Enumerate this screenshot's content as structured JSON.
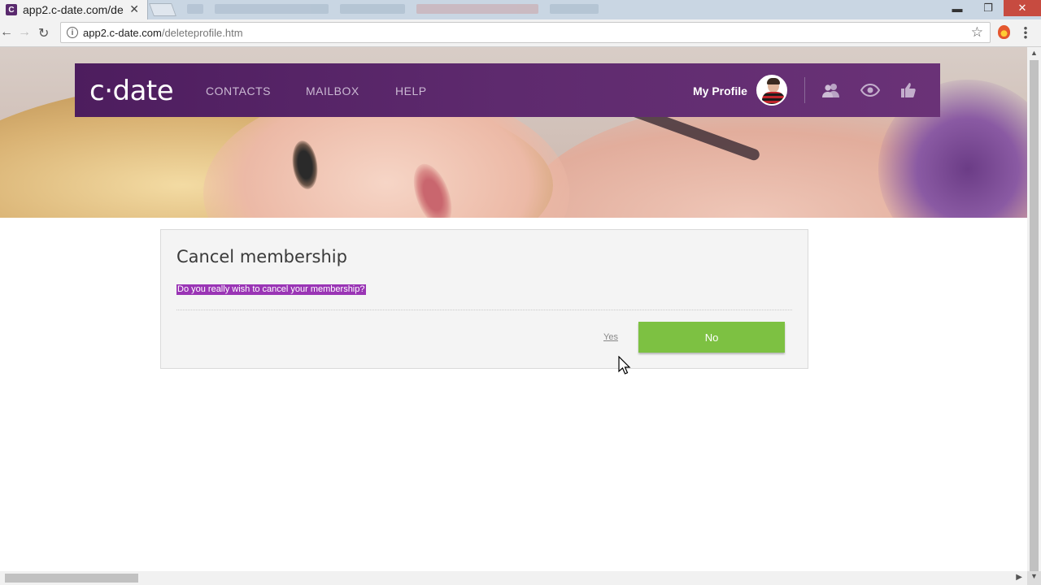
{
  "browser": {
    "tab_title": "app2.c-date.com/de",
    "tab_favicon": "C",
    "tab_close": "✕",
    "url_domain": "app2.c-date.com",
    "url_path": "/deleteprofile.htm",
    "window_controls": {
      "minimize": "▬",
      "restore": "❐",
      "close": "✕"
    }
  },
  "navbar": {
    "logo": "c·date",
    "links": [
      "CONTACTS",
      "MAILBOX",
      "HELP"
    ],
    "my_profile": "My Profile",
    "icons": [
      "contacts-icon",
      "visitors-eye-icon",
      "likes-thumb-icon"
    ]
  },
  "panel": {
    "title": "Cancel membership",
    "question": "Do you really wish to cancel your membership?",
    "yes_label": "Yes",
    "no_label": "No"
  },
  "colors": {
    "brand_purple": "#5e2a6e",
    "button_green": "#7dc142",
    "highlight": "#9a35b5"
  }
}
